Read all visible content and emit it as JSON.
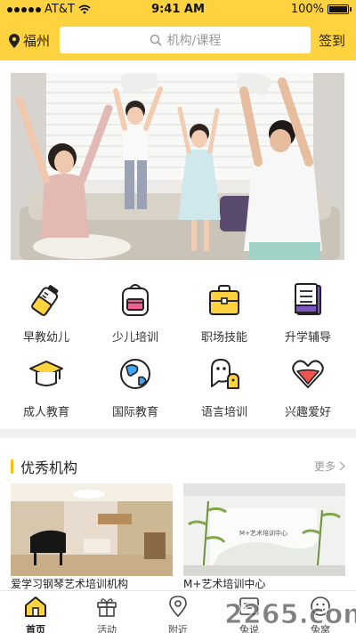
{
  "status": {
    "carrier": "AT&T",
    "time": "9:41 AM",
    "battery": "100%"
  },
  "header": {
    "city": "福州",
    "search_placeholder": "机构/课程",
    "signin": "签到"
  },
  "categories": [
    {
      "label": "早教幼儿",
      "icon": "baby-bottle-icon"
    },
    {
      "label": "少儿培训",
      "icon": "backpack-icon"
    },
    {
      "label": "职场技能",
      "icon": "briefcase-icon"
    },
    {
      "label": "升学辅导",
      "icon": "book-icon"
    },
    {
      "label": "成人教育",
      "icon": "graduation-cap-icon"
    },
    {
      "label": "国际教育",
      "icon": "globe-icon"
    },
    {
      "label": "语言培训",
      "icon": "speech-icon"
    },
    {
      "label": "兴趣爱好",
      "icon": "heart-icon"
    }
  ],
  "section": {
    "title": "优秀机构",
    "more": "更多"
  },
  "cards": [
    {
      "caption": "爱学习钢琴艺术培训机构"
    },
    {
      "caption": "M+艺术培训中心",
      "sign": "M+艺术培训中心"
    }
  ],
  "tabs": [
    {
      "label": "首页",
      "icon": "home-icon",
      "active": true
    },
    {
      "label": "活动",
      "icon": "gift-icon"
    },
    {
      "label": "附近",
      "icon": "location-icon"
    },
    {
      "label": "兔说",
      "icon": "chat-icon"
    },
    {
      "label": "兔窝",
      "icon": "profile-icon"
    }
  ],
  "watermark": "2265.com",
  "colors": {
    "brand_yellow": "#FFD23F",
    "accent": "#FFC107"
  }
}
